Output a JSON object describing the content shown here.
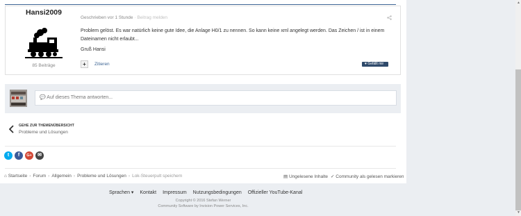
{
  "post": {
    "author": "Hansi2009",
    "posts_count": "85 Beiträge",
    "meta_written": "Geschrieben vor 1 Stunde",
    "meta_report": "· Beitrag melden",
    "body": "Problem gelöst. Es war natürlich keine gute Idee, die Anlage H0/1 zu nennen. So kann keine xml angelegt werden. Das Zeichen / ist in einem Dateinamen nicht erlaubt...",
    "greeting": "Gruß Hansi",
    "plus_label": "+",
    "quote_label": "Zitieren",
    "like_label": "Gefällt mir",
    "icons": {
      "share": "share-icon",
      "like": "heart-icon",
      "quote": "quote-icon"
    }
  },
  "reply": {
    "placeholder": "Auf dieses Thema antworten..."
  },
  "back": {
    "small_label": "GEHE ZUR THEMENÜBERSICHT",
    "title": "Probleme und Lösungen"
  },
  "social": {
    "twitter": "t",
    "facebook": "f",
    "google": "G+",
    "email": "✉",
    "colors": {
      "twitter": "#00abf0",
      "facebook": "#3a5998",
      "google": "#d34836",
      "email": "#444444"
    }
  },
  "breadcrumb": {
    "items": [
      "Startseite",
      "Forum",
      "Allgemein",
      "Probleme und Lösungen",
      "Lok-Steuerpult speichern"
    ],
    "unread": "Ungelesene Inhalte",
    "mark_read": "Community als gelesen markieren"
  },
  "footer": {
    "links": [
      "Sprachen ▾",
      "Kontakt",
      "Impressum",
      "Nutzungsbedingungen",
      "Offizieller YouTube-Kanal"
    ],
    "copyright": "Copyright © 2016 Stefan Werner",
    "software": "Community Software by Invision Power Services, Inc."
  },
  "colors": {
    "accent": "#3d6594",
    "page_bg": "#ebeef2",
    "like_bg": "#2f4a6b"
  }
}
